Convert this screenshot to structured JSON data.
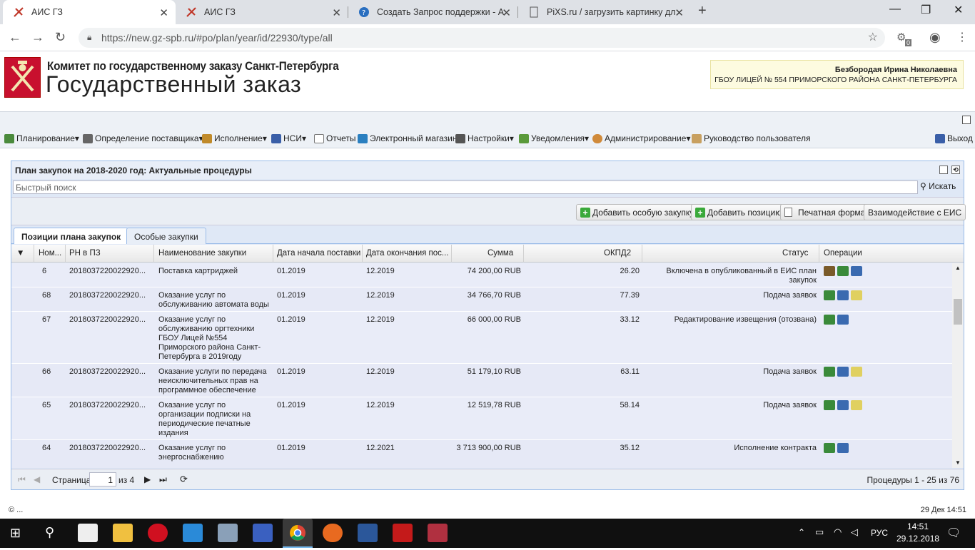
{
  "browser": {
    "tabs": [
      {
        "title": "АИС ГЗ",
        "active": true
      },
      {
        "title": "АИС ГЗ",
        "active": false
      },
      {
        "title": "Создать Запрос поддержки - А",
        "active": false
      },
      {
        "title": "PiXS.ru / загрузить картинку дл",
        "active": false
      }
    ],
    "new_tab": "+",
    "url": "https://new.gz-spb.ru/#po/plan/year/id/22930/type/all",
    "ext_badge": "0"
  },
  "header": {
    "org": "Комитет по государственному заказу Санкт-Петербурга",
    "site_title": "Государственный заказ",
    "user_name": "Безбородая Ирина Николаевна",
    "user_org": "ГБОУ ЛИЦЕЙ № 554 ПРИМОРСКОГО РАЙОНА САНКТ-ПЕТЕРБУРГА"
  },
  "menu": {
    "items": [
      {
        "label": "Планирование",
        "dropdown": true,
        "color": "#4a8a3c"
      },
      {
        "label": "Определение поставщика",
        "dropdown": true,
        "color": "#666666"
      },
      {
        "label": "Исполнение",
        "dropdown": true,
        "color": "#c08a2a"
      },
      {
        "label": "НСИ",
        "dropdown": true,
        "color": "#3a5fa8"
      },
      {
        "label": "Отчеты",
        "dropdown": false,
        "color": "#777777"
      },
      {
        "label": "Электронный магазин",
        "dropdown": false,
        "color": "#2a7fc0"
      },
      {
        "label": "Настройки",
        "dropdown": true,
        "color": "#555555"
      },
      {
        "label": "Уведомления",
        "dropdown": true,
        "color": "#5a9a3a"
      },
      {
        "label": "Администрирование",
        "dropdown": true,
        "color": "#d08a3a"
      },
      {
        "label": "Руководство пользователя",
        "dropdown": false,
        "color": "#c8a060"
      }
    ],
    "logout": "Выход"
  },
  "panel": {
    "title": "План закупок на 2018-2020 год: Актуальные процедуры",
    "search_placeholder": "Быстрый поиск",
    "search_button": "Искать",
    "buttons": {
      "add_special": "Добавить особую закупку",
      "add_position": "Добавить позицию",
      "print": "Печатная форма",
      "eis": "Взаимодействие с ЕИС"
    },
    "tabs": [
      {
        "label": "Позиции плана закупок",
        "active": true
      },
      {
        "label": "Особые закупки",
        "active": false
      }
    ]
  },
  "grid": {
    "columns": [
      "Ном...",
      "РН в ПЗ",
      "Наименование закупки",
      "Дата начала поставки",
      "Дата окончания пос...",
      "Сумма",
      "ОКПД2",
      "Статус",
      "Операции"
    ],
    "rows": [
      {
        "num": "6",
        "rn": "2018037220022920...",
        "name": "Поставка картриджей",
        "start": "01.2019",
        "end": "12.2019",
        "sum": "74 200,00 RUB",
        "okpd": "26.20",
        "status": "Включена в опубликованный в ЕИС план закупок",
        "ops": [
          "edit",
          "settings",
          "chart"
        ]
      },
      {
        "num": "68",
        "rn": "2018037220022920...",
        "name": "Оказание услуг по обслуживанию автомата воды",
        "start": "01.2019",
        "end": "12.2019",
        "sum": "34 766,70 RUB",
        "okpd": "77.39",
        "status": "Подача заявок",
        "ops": [
          "settings",
          "chart",
          "notes"
        ]
      },
      {
        "num": "67",
        "rn": "2018037220022920...",
        "name": "Оказание услуг по обслуживанию оргтехники ГБОУ Лицей №554 Приморского района Санкт-Петербурга в 2019году",
        "start": "01.2019",
        "end": "12.2019",
        "sum": "66 000,00 RUB",
        "okpd": "33.12",
        "status": "Редактирование извещения (отозвана)",
        "ops": [
          "settings",
          "chart"
        ]
      },
      {
        "num": "66",
        "rn": "2018037220022920...",
        "name": "Оказание услуги по передача неисключительных прав на программное обеспечение",
        "start": "01.2019",
        "end": "12.2019",
        "sum": "51 179,10 RUB",
        "okpd": "63.11",
        "status": "Подача заявок",
        "ops": [
          "settings",
          "chart",
          "notes"
        ]
      },
      {
        "num": "65",
        "rn": "2018037220022920...",
        "name": "Оказание услуг по организации подписки на периодические печатные издания",
        "start": "01.2019",
        "end": "12.2019",
        "sum": "12 519,78 RUB",
        "okpd": "58.14",
        "status": "Подача заявок",
        "ops": [
          "settings",
          "chart",
          "notes"
        ]
      },
      {
        "num": "64",
        "rn": "2018037220022920...",
        "name": "Оказание услуг по энергоснабжению",
        "start": "01.2019",
        "end": "12.2021",
        "sum": "3 713 900,00 RUB",
        "okpd": "35.12",
        "status": "Исполнение контракта",
        "ops": [
          "settings",
          "chart"
        ]
      }
    ]
  },
  "pager": {
    "page_label": "Страница",
    "page": "1",
    "of": "из 4",
    "summary": "Процедуры 1 - 25 из 76"
  },
  "statusbar": {
    "left": "© ...",
    "right": "29 Дек 14:51"
  },
  "taskbar": {
    "lang": "РУС",
    "time": "14:51",
    "date": "29.12.2018"
  }
}
